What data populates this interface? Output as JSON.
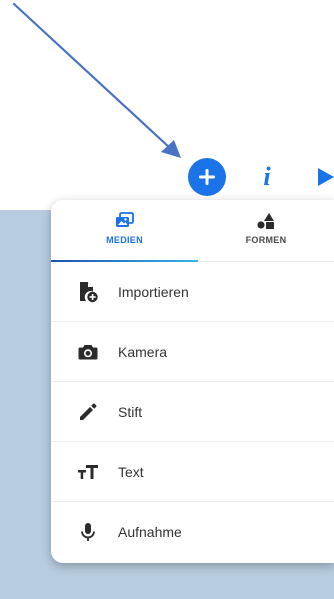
{
  "colors": {
    "accent": "#1a73e8",
    "arrow": "#4a72c4",
    "bottom_background": "#b8cce1",
    "tab_inactive": "#4a4a4a",
    "icon": "#2b2b2b",
    "text": "#333333",
    "indicator_start": "#2051a8",
    "indicator_end": "#33b6ea"
  },
  "toolbar": {
    "add_icon": "plus-icon",
    "info_glyph": "i",
    "play_icon": "play-icon"
  },
  "tabs": [
    {
      "label": "MEDIEN",
      "icon": "image-gallery-icon",
      "active": true
    },
    {
      "label": "FORMEN",
      "icon": "shapes-icon",
      "active": false
    }
  ],
  "items": [
    {
      "label": "Importieren",
      "icon": "file-add-icon"
    },
    {
      "label": "Kamera",
      "icon": "camera-icon"
    },
    {
      "label": "Stift",
      "icon": "pen-icon"
    },
    {
      "label": "Text",
      "icon": "text-size-icon"
    },
    {
      "label": "Aufnahme",
      "icon": "microphone-icon"
    }
  ]
}
